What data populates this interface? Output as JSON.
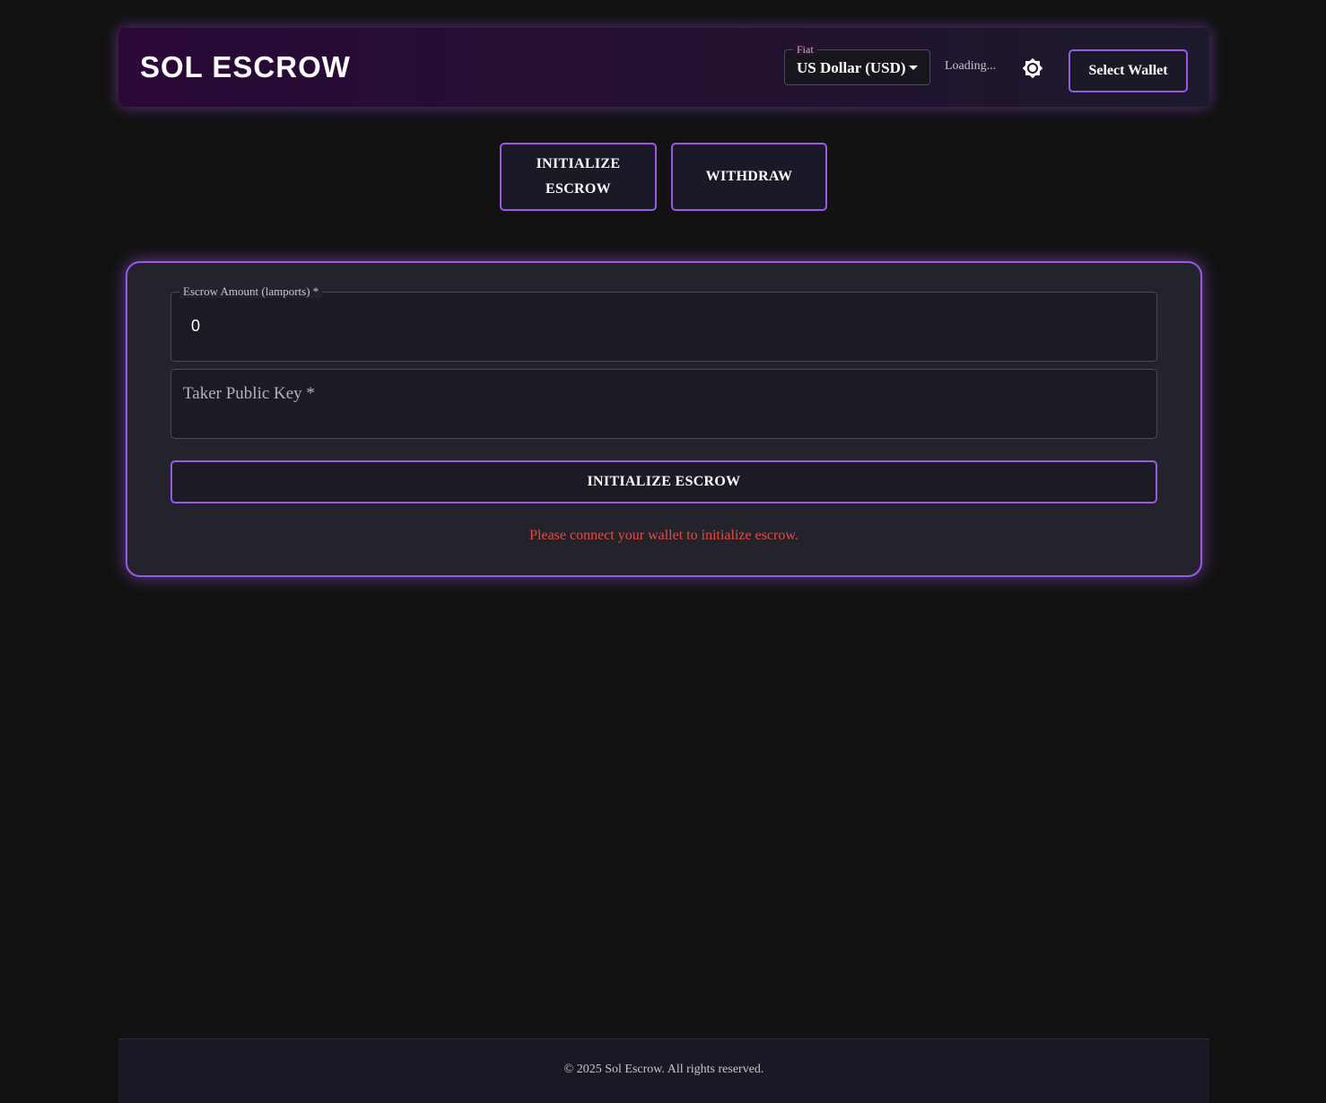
{
  "header": {
    "brand": "SOL ESCROW",
    "fiat_label": "Fiat",
    "fiat_value": "US Dollar (USD)",
    "price_status": "Loading...",
    "theme_icon": "brightness-icon",
    "wallet_button": "Select Wallet"
  },
  "tabs": [
    {
      "label": "INITIALIZE ESCROW"
    },
    {
      "label": "WITHDRAW"
    }
  ],
  "form": {
    "amount_label": "Escrow Amount (lamports) *",
    "amount_value": "0",
    "taker_label": "Taker Public Key *",
    "taker_value": "",
    "submit_label": "INITIALIZE ESCROW",
    "error": "Please connect your wallet to initialize escrow."
  },
  "footer": {
    "text": "© 2025 Sol Escrow. All rights reserved."
  },
  "colors": {
    "accent": "#9b59e8",
    "error": "#e84a3c",
    "background": "#121212"
  }
}
